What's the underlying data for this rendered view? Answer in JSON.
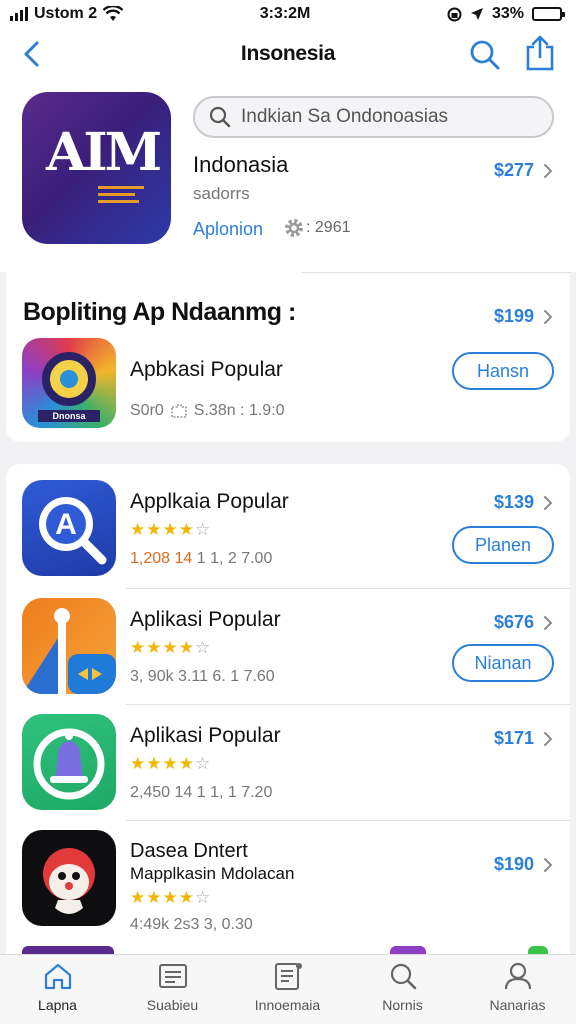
{
  "status_bar": {
    "carrier": "Ustom 2",
    "time": "3:3:2M",
    "battery_percent": "33%",
    "battery_level": 0.33,
    "battery_color": "#3cc34a"
  },
  "nav": {
    "title": "Insonesia",
    "icons": [
      "back-chevron-icon",
      "search-icon",
      "share-icon"
    ]
  },
  "hero": {
    "app_name": "Indonasia",
    "subtitle": "sadorrs",
    "price": "$277",
    "link": "Aplonion",
    "count": ": 2961",
    "search": {
      "value": "Indkian Sa Ondonoasias"
    },
    "icon_monogram": "AIM"
  },
  "featured": {
    "title": "Bopliting Ap Ndaanmg :",
    "price": "$199",
    "app": {
      "name": "Apbkasi Popular",
      "meta_left": "S0r0",
      "meta_right": "S.38n : 1.9:0",
      "button": "Hansn",
      "icon_tag": "Dnonsa"
    }
  },
  "apps": [
    {
      "name": "Applkaia Popular",
      "subtitle": "",
      "rating": 4.5,
      "meta": "1,208 14 1 1, 2 7.00",
      "price": "$139",
      "button": "Planen",
      "icon": "search-a-icon"
    },
    {
      "name": "Aplikasi Popular",
      "subtitle": "",
      "rating": 4.5,
      "meta": "3, 90k 3.11 6. 1 7.60",
      "price": "$676",
      "button": "Nianan",
      "icon": "map-pin-icon"
    },
    {
      "name": "Aplikasi Popular",
      "subtitle": "",
      "rating": 4.5,
      "meta": "2,450 14 1 1, 1 7.20",
      "price": "$171",
      "button": "",
      "icon": "bell-icon"
    },
    {
      "name": "Dasea Dntert",
      "subtitle": "Mapplkasin Mdolacan",
      "rating": 4.5,
      "meta": "4:49k 2s3 3, 0.30",
      "price": "$190",
      "button": "",
      "icon": "clown-face-icon"
    }
  ],
  "tabs": [
    {
      "label": "Lapna",
      "icon": "home-icon",
      "active": true
    },
    {
      "label": "Suabieu",
      "icon": "list-icon",
      "active": false
    },
    {
      "label": "Innoemaia",
      "icon": "document-icon",
      "active": false
    },
    {
      "label": "Nornis",
      "icon": "search-icon",
      "active": false
    },
    {
      "label": "Nanarias",
      "icon": "person-icon",
      "active": false
    }
  ],
  "colors": {
    "accent": "#2b7fd8",
    "star": "#f2b705",
    "meta_highlight": "#e06a1e"
  }
}
